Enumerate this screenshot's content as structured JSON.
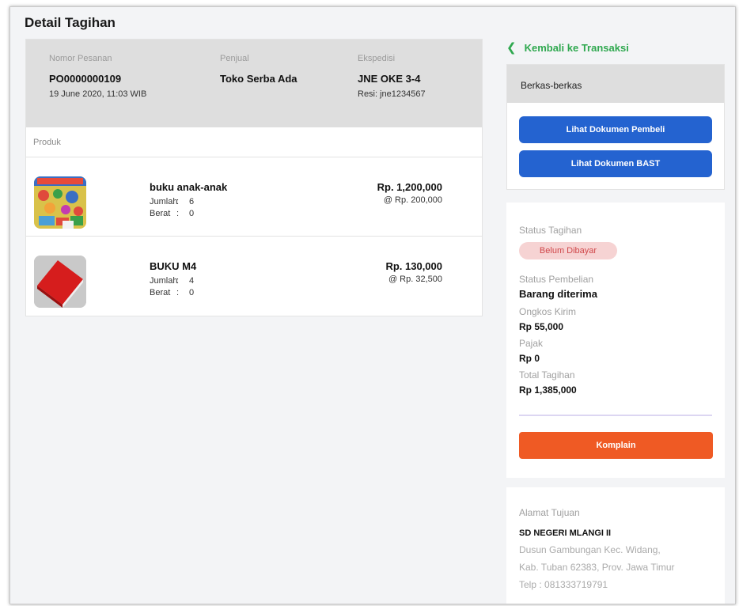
{
  "page": {
    "title": "Detail Tagihan"
  },
  "order": {
    "nomor_label": "Nomor Pesanan",
    "nomor_value": "PO0000000109",
    "date": "19 June 2020, 11:03 WIB",
    "penjual_label": "Penjual",
    "penjual_value": "Toko Serba Ada",
    "ekspedisi_label": "Ekspedisi",
    "ekspedisi_value": "JNE OKE 3-4",
    "resi": "Resi: jne1234567"
  },
  "products": {
    "header": "Produk",
    "items": [
      {
        "name": "buku anak-anak",
        "jumlah_label": "Jumlah",
        "jumlah_value": "6",
        "berat_label": "Berat",
        "berat_value": "0",
        "sep": ":",
        "price": "Rp. 1,200,000",
        "unit_price": "@ Rp. 200,000",
        "image": "children-book-cover"
      },
      {
        "name": "BUKU M4",
        "jumlah_label": "Jumlah",
        "jumlah_value": "4",
        "berat_label": "Berat",
        "berat_value": "0",
        "sep": ":",
        "price": "Rp. 130,000",
        "unit_price": "@ Rp. 32,500",
        "image": "red-book"
      }
    ]
  },
  "sidebar": {
    "back_label": "Kembali ke Transaksi",
    "back_icon": "chevron-left-icon",
    "files_title": "Berkas-berkas",
    "btn_pembeli": "Lihat Dokumen Pembeli",
    "btn_bast": "Lihat Dokumen BAST"
  },
  "status": {
    "tagihan_label": "Status Tagihan",
    "tagihan_badge": "Belum Dibayar",
    "pembelian_label": "Status Pembelian",
    "pembelian_value": "Barang diterima",
    "ongkir_label": "Ongkos Kirim",
    "ongkir_value": "Rp 55,000",
    "pajak_label": "Pajak",
    "pajak_value": "Rp 0",
    "total_label": "Total Tagihan",
    "total_value": "Rp 1,385,000",
    "komplain_label": "Komplain"
  },
  "address": {
    "title": "Alamat Tujuan",
    "name": "SD NEGERI MLANGI II",
    "line1": "Dusun Gambungan Kec. Widang,",
    "line2": "Kab. Tuban 62383, Prov. Jawa Timur",
    "phone": "Telp : 081333719791"
  },
  "colors": {
    "accent_green": "#2fa84f",
    "button_blue": "#2463d0",
    "button_orange": "#ef5a24",
    "badge_bg": "#f6d3d3",
    "badge_text": "#d0474a"
  }
}
